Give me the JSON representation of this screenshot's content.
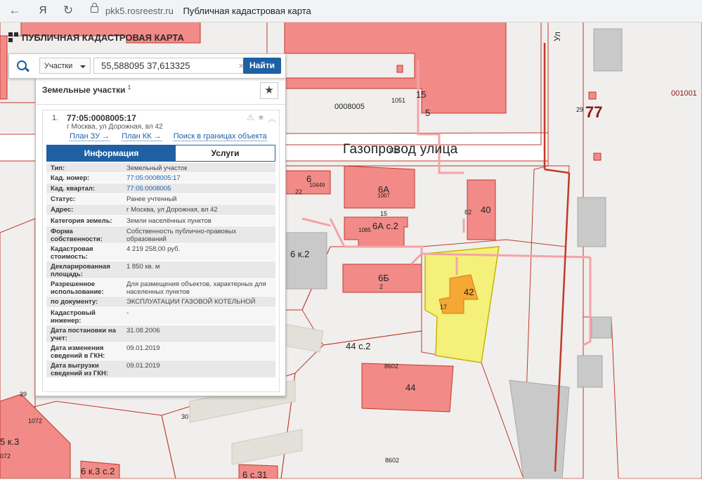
{
  "browser": {
    "back_icon": "arrow-left-icon",
    "yandex_label": "Я",
    "reload_icon": "reload-icon",
    "url_host": "pkk5.rosreestr.ru",
    "page_title": "Публичная кадастровая карта"
  },
  "app": {
    "title": "ПУБЛИЧНАЯ КАДАСТРОВАЯ КАРТА"
  },
  "search": {
    "category": "Участки",
    "query": "55,588095 37,613325",
    "clear": "×",
    "button": "Найти"
  },
  "panel": {
    "title": "Земельные участки",
    "count": "1",
    "item": {
      "index": "1.",
      "cad_number": "77:05:0008005:17",
      "address": "г Москва, ул Дорожная, вл 42",
      "links": [
        "План ЗУ →",
        "План КК →",
        "Поиск в границах объекта →"
      ],
      "tabs": [
        "Информация",
        "Услуги"
      ],
      "rows": [
        {
          "k": "Тип:",
          "v": "Земельный участок"
        },
        {
          "k": "Кад. номер:",
          "v": "77:05:0008005:17",
          "link": true
        },
        {
          "k": "Кад. квартал:",
          "v": "77:05:0008005",
          "link": true
        },
        {
          "k": "Статус:",
          "v": "Ранее учтенный"
        },
        {
          "k": "Адрес:",
          "v": "г Москва, ул Дорожная, вл 42"
        },
        {
          "k": "Категория земель:",
          "v": "Земли населённых пунктов"
        },
        {
          "k": "Форма собственности:",
          "v": "Собственность публично-правовых образований"
        },
        {
          "k": "Кадастровая стоимость:",
          "v": "4 219 258,00 руб."
        },
        {
          "k": "Декларированная площадь:",
          "v": "1 850 кв. м"
        },
        {
          "k": "Разрешенное использование:",
          "v": "Для размещения объектов, характерных для населенных пунктов"
        },
        {
          "k": "по документу:",
          "v": "ЭКСПЛУАТАЦИИ ГАЗОВОЙ КОТЕЛЬНОЙ"
        },
        {
          "k": "Кадастровый инженер:",
          "v": "-"
        },
        {
          "k": "Дата постановки на учет:",
          "v": "31.08.2006"
        },
        {
          "k": "Дата изменения сведений в ГКН:",
          "v": "09.01.2019"
        },
        {
          "k": "Дата выгрузки сведений из ГКН:",
          "v": "09.01.2019"
        }
      ]
    }
  },
  "map": {
    "street": "Газопровод улица",
    "labels": {
      "b15": "15",
      "b5": "5",
      "q0008005": "0008005",
      "n1051": "1051",
      "q77": "77",
      "n29": "29",
      "q001001": "001001",
      "ul": "Ул",
      "b6": "6",
      "n22": "22",
      "n10449": "10449",
      "b6A": "6А",
      "n1067": "1067",
      "n15": "15",
      "b6Ac2": "6А с.2",
      "n1085": "1085",
      "b40": "40",
      "n82": "82",
      "n102": "102",
      "b6k2": "6 к.2",
      "b6B": "6Б",
      "n2": "2",
      "b42": "42",
      "n17": "17",
      "b44c2": "44 с.2",
      "n8602a": "8602",
      "b44": "44",
      "n39": "39",
      "n1072": "1072",
      "b5k3": "5 к.3",
      "n072": "072",
      "n30": "30",
      "b6k3c2": "6 к.3 с.2",
      "b6c31": "6 с.31",
      "n8602b": "8602"
    }
  }
}
